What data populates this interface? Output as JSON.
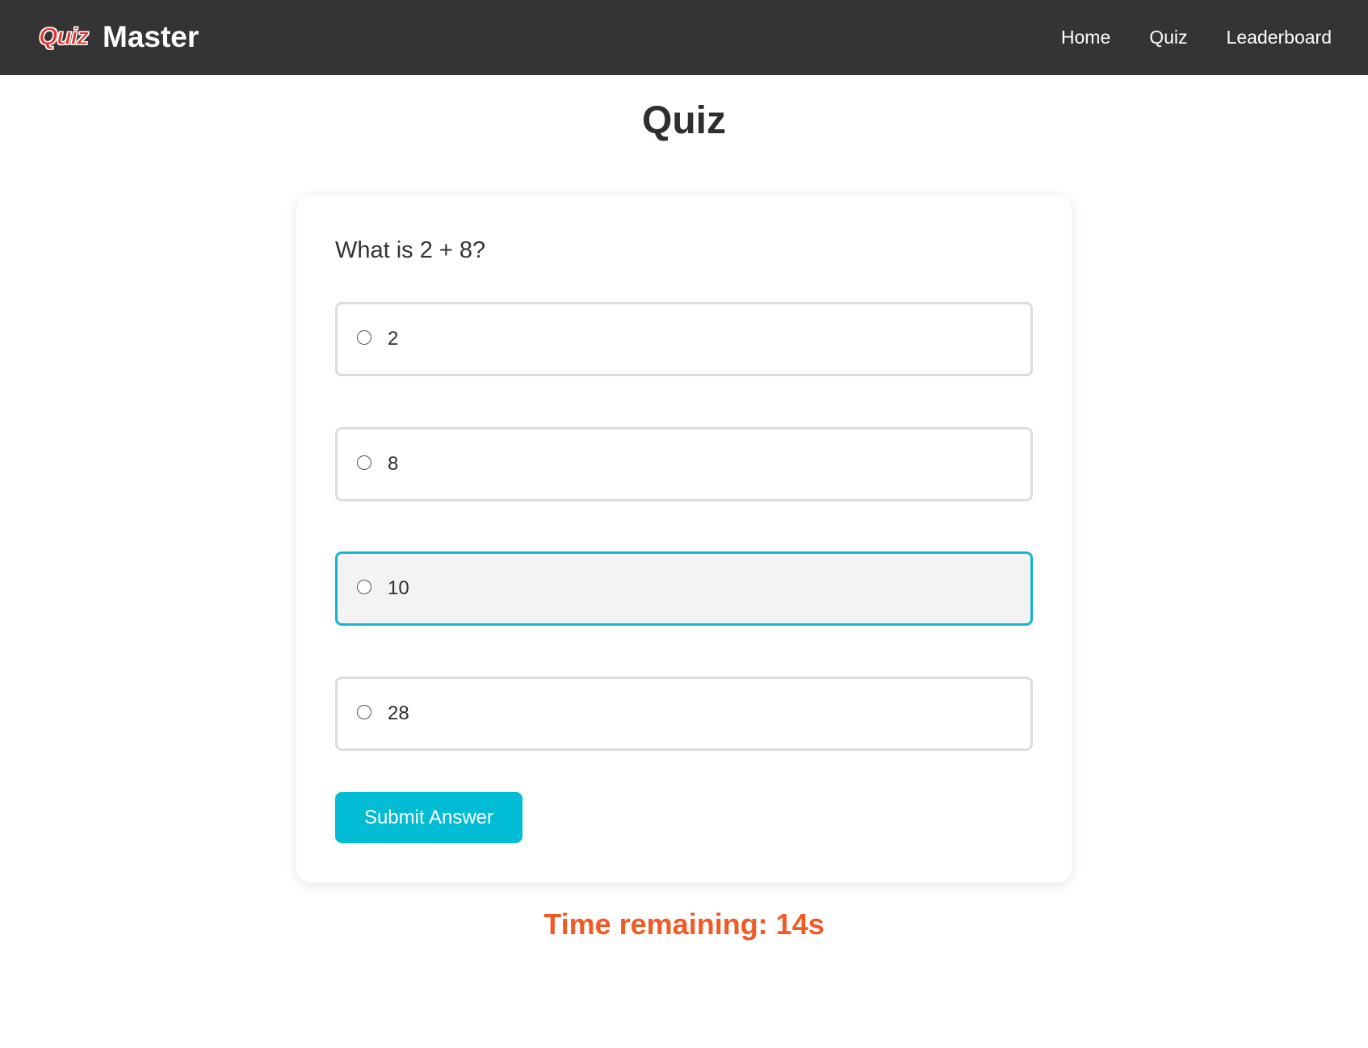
{
  "navbar": {
    "logo_text": "Quiz",
    "brand_name": "Master",
    "links": [
      {
        "label": "Home"
      },
      {
        "label": "Quiz"
      },
      {
        "label": "Leaderboard"
      }
    ]
  },
  "page": {
    "title": "Quiz"
  },
  "quiz": {
    "question": "What is 2 + 8?",
    "options": [
      {
        "label": "2",
        "selected": false,
        "hovered": false
      },
      {
        "label": "8",
        "selected": false,
        "hovered": false
      },
      {
        "label": "10",
        "selected": false,
        "hovered": true
      },
      {
        "label": "28",
        "selected": false,
        "hovered": false
      }
    ],
    "submit_label": "Submit Answer"
  },
  "timer": {
    "text": "Time remaining: 14s"
  },
  "colors": {
    "navbar_bg": "#343434",
    "accent": "#00bcd4",
    "timer": "#f15a24",
    "logo": "#e8322c"
  }
}
